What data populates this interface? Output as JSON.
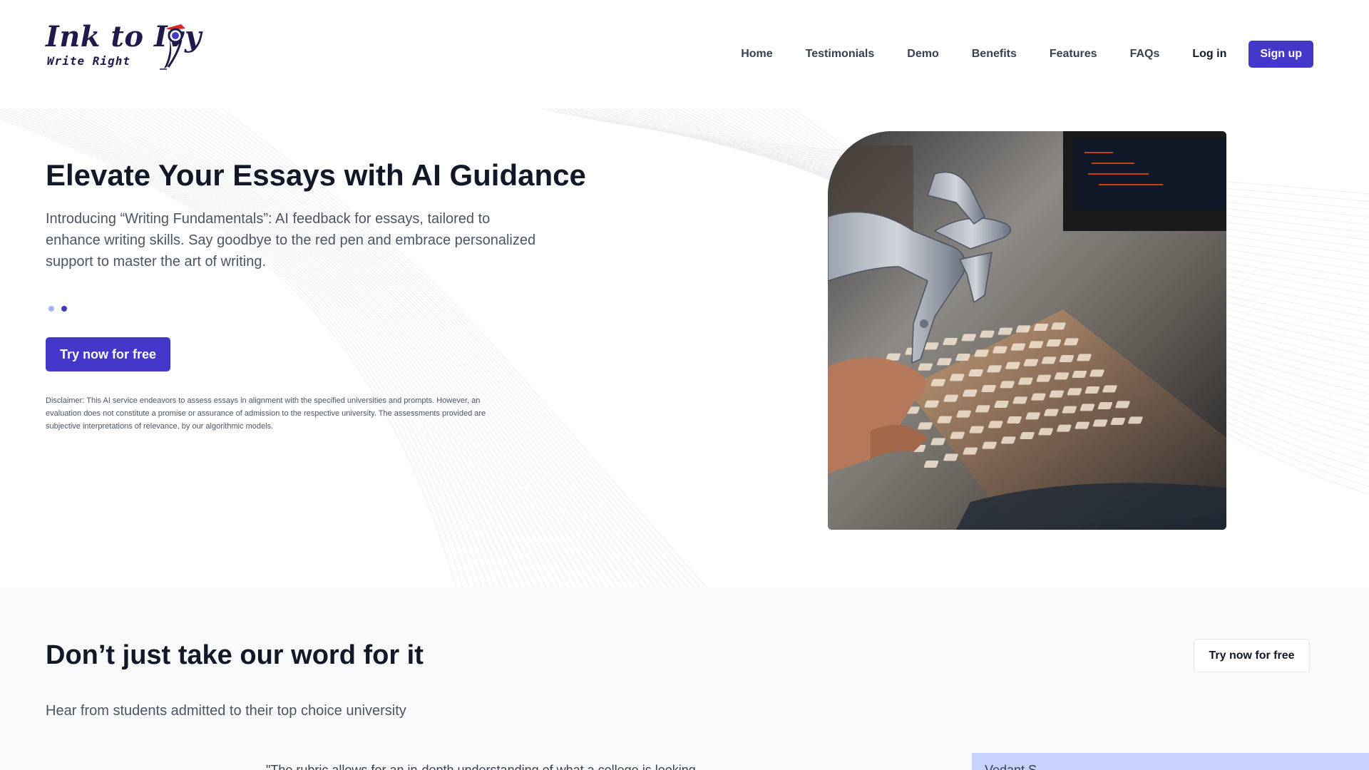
{
  "logo": {
    "title": "Ink to Ivy",
    "subtitle": "Write Right"
  },
  "nav": {
    "items": [
      "Home",
      "Testimonials",
      "Demo",
      "Benefits",
      "Features",
      "FAQs"
    ],
    "login": "Log in",
    "signup": "Sign up"
  },
  "hero": {
    "title": "Elevate Your Essays with AI Guidance",
    "description": "Introducing “Writing Fundamentals”: AI feedback for essays, tailored to enhance writing skills. Say goodbye to the red pen and embrace personalized support to master the art of writing.",
    "carousel": {
      "count": 2,
      "active": 2
    },
    "cta": "Try now for free",
    "disclaimer": "Disclaimer: This AI service endeavors to assess essays in alignment with the specified universities and prompts. However, an evaluation does not constitute a promise or assurance of admission to the respective university. The assessments provided are subjective interpretations of relevance, by our algorithmic models."
  },
  "testimonials": {
    "title": "Don’t just take our word for it",
    "subtitle": "Hear from students admitted to their top choice university",
    "cta": "Try now for free",
    "quote_preview": "\"The rubric allows for an in-depth understanding of what a college is looking",
    "card_name": "Vedant S."
  },
  "colors": {
    "accent": "#4338ca",
    "text_dark": "#111827",
    "text_muted": "#4b5563",
    "section_bg": "#f9fafb",
    "card_bg": "#c7d2fe"
  },
  "icons": {
    "logo_mark": "pen-icon"
  }
}
